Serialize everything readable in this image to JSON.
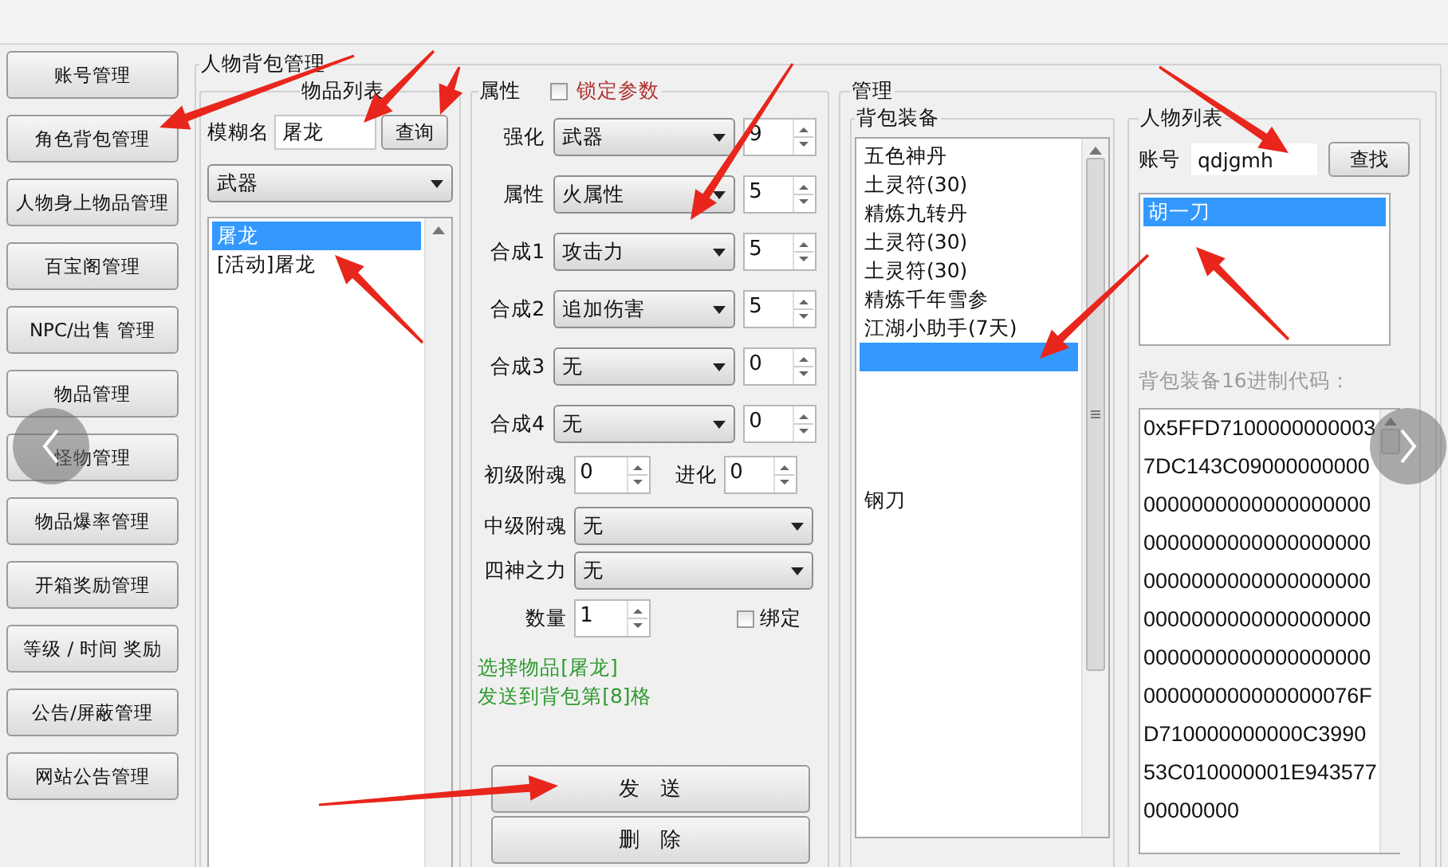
{
  "nav": [
    {
      "label": "账号管理",
      "selected": false
    },
    {
      "label": "角色背包管理",
      "selected": false
    },
    {
      "label": "人物身上物品管理",
      "selected": false
    },
    {
      "label": "百宝阁管理",
      "selected": false
    },
    {
      "label": "NPC/出售 管理",
      "selected": false
    },
    {
      "label": "物品管理",
      "selected": false
    },
    {
      "label": "怪物管理",
      "selected": false
    },
    {
      "label": "物品爆率管理",
      "selected": false
    },
    {
      "label": "开箱奖励管理",
      "selected": false
    },
    {
      "label": "等级 / 时间 奖励",
      "selected": false
    },
    {
      "label": "公告/屏蔽管理",
      "selected": false
    },
    {
      "label": "网站公告管理",
      "selected": false
    }
  ],
  "group": {
    "title": "人物背包管理"
  },
  "item_list": {
    "title": "物品列表",
    "search_label": "模糊名",
    "search_value": "屠龙",
    "search_button": "查询",
    "category": "武器",
    "items": [
      {
        "text": "屠龙",
        "selected": true
      },
      {
        "text": "[活动]屠龙",
        "selected": false
      }
    ]
  },
  "attributes": {
    "title": "属性",
    "lock": {
      "label": "锁定参数",
      "checked": false
    },
    "rows": [
      {
        "label": "强化",
        "option": "武器",
        "value": "9"
      },
      {
        "label": "属性",
        "option": "火属性",
        "value": "5"
      },
      {
        "label": "合成1",
        "option": "攻击力",
        "value": "5"
      },
      {
        "label": "合成2",
        "option": "追加伤害",
        "value": "5"
      },
      {
        "label": "合成3",
        "option": "无",
        "value": "0"
      },
      {
        "label": "合成4",
        "option": "无",
        "value": "0"
      }
    ],
    "basic_soul": {
      "label": "初级附魂",
      "value": "0"
    },
    "evolve": {
      "label": "进化",
      "value": "0"
    },
    "mid_soul": {
      "label": "中级附魂",
      "option": "无"
    },
    "four_gods": {
      "label": "四神之力",
      "option": "无"
    },
    "quantity": {
      "label": "数量",
      "value": "1"
    },
    "bind": {
      "label": "绑定",
      "checked": false
    },
    "status": [
      "选择物品[屠龙]",
      "发送到背包第[8]格"
    ],
    "buttons": [
      "发　送",
      "删　除"
    ]
  },
  "manage": {
    "title": "管理",
    "backpack": {
      "title": "背包装备",
      "slots": [
        {
          "text": "五色神丹",
          "selected": false
        },
        {
          "text": "土灵符(30)",
          "selected": false
        },
        {
          "text": "精炼九转丹",
          "selected": false
        },
        {
          "text": "土灵符(30)",
          "selected": false
        },
        {
          "text": "土灵符(30)",
          "selected": false
        },
        {
          "text": "精炼千年雪参",
          "selected": false
        },
        {
          "text": "江湖小助手(7天)",
          "selected": false
        },
        {
          "selected": true
        },
        {
          "selected": false
        },
        {
          "selected": false
        },
        {
          "selected": false
        },
        {
          "selected": false
        },
        {
          "text": "钢刀",
          "selected": false
        }
      ]
    },
    "characters": {
      "title": "人物列表",
      "account_label": "账号",
      "account_value": "qdjgmh",
      "find_button": "查找",
      "items": [
        {
          "text": "胡一刀",
          "selected": true
        }
      ],
      "hex_label": "背包装备16进制代码：",
      "hex_lines": [
        "0x5FFD7100000000003",
        "7DC143C09000000000",
        "0000000000000000000",
        "0000000000000000000",
        "0000000000000000000",
        "0000000000000000000",
        "0000000000000000000",
        "000000000000000076F",
        "D710000000000C3990",
        "53C010000001E943577",
        "00000000"
      ]
    }
  }
}
